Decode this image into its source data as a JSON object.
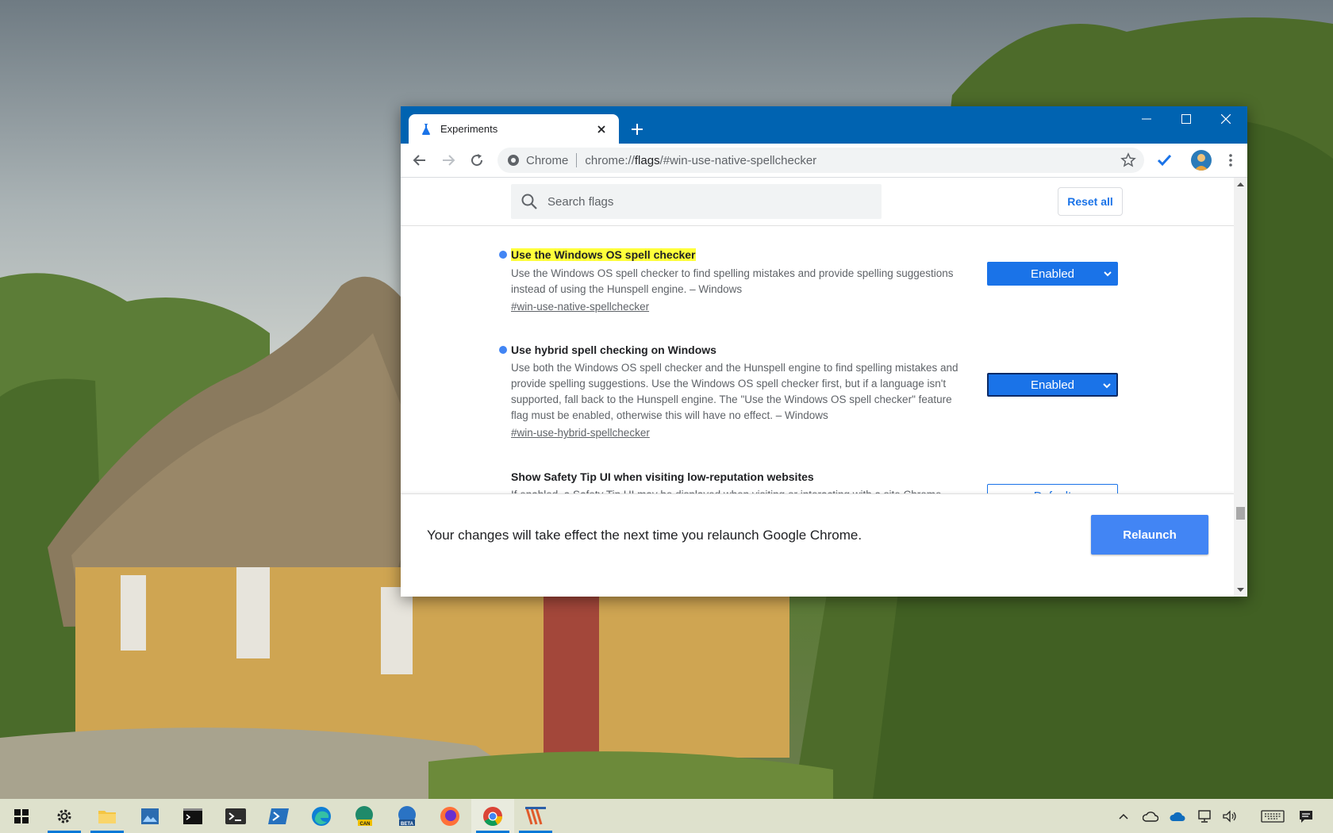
{
  "browser": {
    "tab_title": "Experiments",
    "omnibox": {
      "site_label": "Chrome",
      "url_scheme": "chrome://",
      "url_host": "flags",
      "url_path": "/#win-use-native-spellchecker"
    }
  },
  "flags_page": {
    "search_placeholder": "Search flags",
    "reset_label": "Reset all",
    "flags": [
      {
        "name": "Use the Windows OS spell checker",
        "description": "Use the Windows OS spell checker to find spelling mistakes and provide spelling suggestions instead of using the Hunspell engine. – Windows",
        "link": "#win-use-native-spellchecker",
        "value": "Enabled",
        "modified": true,
        "highlighted": true
      },
      {
        "name": "Use hybrid spell checking on Windows",
        "description": "Use both the Windows OS spell checker and the Hunspell engine to find spelling mistakes and provide spelling suggestions. Use the Windows OS spell checker first, but if a language isn't supported, fall back to the Hunspell engine. The \"Use the Windows OS spell checker\" feature flag must be enabled, otherwise this will have no effect. – Windows",
        "link": "#win-use-hybrid-spellchecker",
        "value": "Enabled",
        "modified": true,
        "highlighted": false
      },
      {
        "name": "Show Safety Tip UI when visiting low-reputation websites",
        "description": "If enabled, a Safety Tip UI may be displayed when visiting or interacting with a site Chrome believes may be suspicious. – Mac, Windows, Linux, Chrome OS, Android",
        "value": "Default",
        "modified": false,
        "highlighted": false
      }
    ],
    "relaunch": {
      "message": "Your changes will take effect the next time you relaunch Google Chrome.",
      "button_label": "Relaunch"
    }
  },
  "taskbar": {
    "icons": [
      "windows-start-icon",
      "settings-icon",
      "file-explorer-icon",
      "photos-icon",
      "command-prompt-icon",
      "windows-terminal-icon",
      "powershell-icon",
      "edge-icon",
      "edge-canary-icon",
      "edge-beta-icon",
      "firefox-icon",
      "chrome-icon",
      "app-icon"
    ],
    "badges": {
      "edge_canary": "CAN",
      "edge_beta": "BETA"
    }
  },
  "colors": {
    "titlebar": "#0063b1",
    "accent": "#1a73e8",
    "relaunch_button": "#4285f4",
    "highlight": "#ffff3b"
  }
}
